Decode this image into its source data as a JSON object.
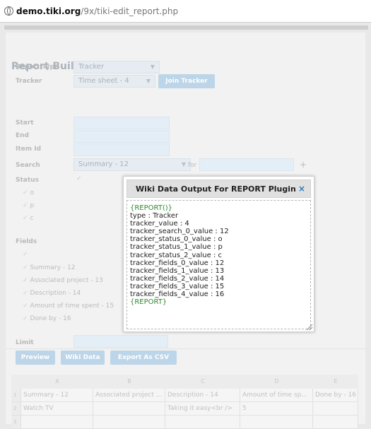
{
  "browser": {
    "url_domain": "demo.tiki.org",
    "url_path": "/9x/tiki-edit_report.php"
  },
  "page": {
    "title": "Report Builder",
    "report_type_label": "Report Type",
    "report_type_value": "Tracker",
    "tracker_label": "Tracker",
    "tracker_value": "Time sheet - 4",
    "join_tracker_button": "Join Tracker",
    "start_label": "Start",
    "end_label": "End",
    "item_id_label": "Item Id",
    "search_label": "Search",
    "search_value": "Summary - 12",
    "for_label": "for",
    "add_symbol": "+",
    "status_label": "Status",
    "status_options": [
      "o",
      "p",
      "c"
    ],
    "fields_label": "Fields",
    "fields_options": [
      "Summary - 12",
      "Associated project - 13",
      "Description - 14",
      "Amount of time spent - 15",
      "Done by - 16"
    ],
    "limit_label": "Limit",
    "buttons": {
      "preview": "Preview",
      "wiki_data": "Wiki Data",
      "export_csv": "Export As CSV"
    }
  },
  "sheet": {
    "columns": [
      "A",
      "B",
      "C",
      "D",
      "E"
    ],
    "rows": [
      {
        "num": "1",
        "cells": [
          "Summary - 12",
          "Associated project ...",
          "Description - 14",
          "Amount of time sp...",
          "Done by - 16"
        ]
      },
      {
        "num": "2",
        "cells": [
          "Watch TV",
          "",
          "Taking it easy<br />",
          "5",
          ""
        ]
      },
      {
        "num": "3",
        "cells": [
          "",
          "",
          "",
          "",
          ""
        ]
      }
    ]
  },
  "dialog": {
    "title": "Wiki Data Output For REPORT Plugin",
    "close_glyph": "×",
    "open_tag": "{REPORT()}",
    "lines": [
      "type : Tracker",
      "tracker_value : 4",
      "tracker_search_0_value : 12",
      "tracker_status_0_value : o",
      "tracker_status_1_value : p",
      "tracker_status_2_value : c",
      "tracker_fields_0_value : 12",
      "tracker_fields_1_value : 13",
      "tracker_fields_2_value : 14",
      "tracker_fields_3_value : 15",
      "tracker_fields_4_value : 16"
    ],
    "close_tag": "{REPORT}"
  },
  "colors": {
    "dialog_header_bg": "#e0e0e0",
    "close_icon": "#2a7ac8",
    "plugin_tag_green": "#2d8a2d",
    "button_blue": "#bcd5e8"
  }
}
